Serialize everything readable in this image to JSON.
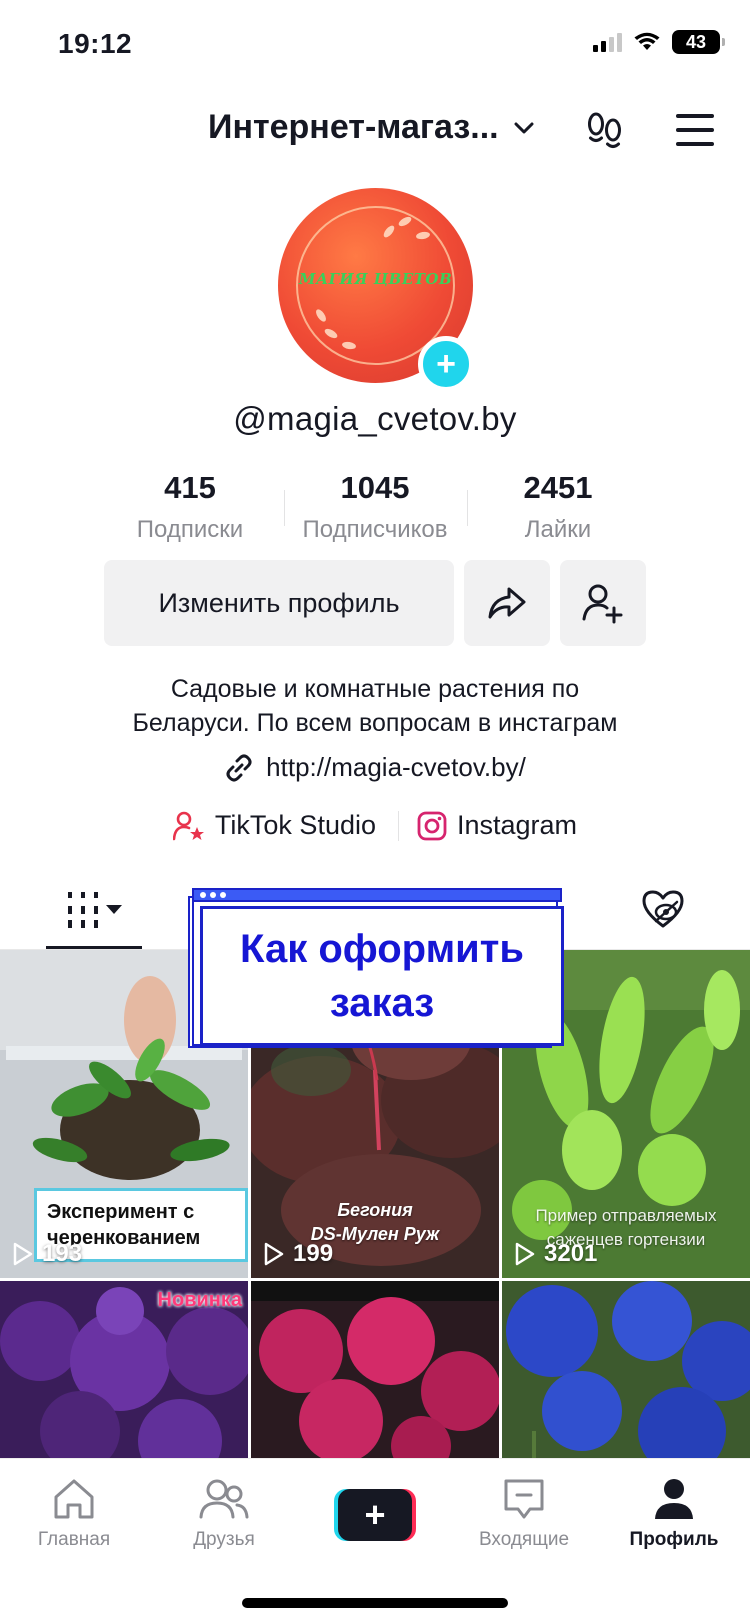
{
  "status": {
    "time": "19:12",
    "battery": "43"
  },
  "header": {
    "title": "Интернет-магаз..."
  },
  "profile": {
    "avatar_logo": "МАГИЯ ЦВЕТОВ",
    "username": "@magia_cvetov.by",
    "stats": [
      {
        "value": "415",
        "label": "Подписки"
      },
      {
        "value": "1045",
        "label": "Подписчиков"
      },
      {
        "value": "2451",
        "label": "Лайки"
      }
    ],
    "edit_button": "Изменить профиль",
    "bio_line1": "Садовые и комнатные растения по",
    "bio_line2": "Беларуси. По всем вопросам в инстаграм",
    "link": "http://magia-cvetov.by/",
    "extras": [
      {
        "label": "TikTok Studio"
      },
      {
        "label": "Instagram"
      }
    ]
  },
  "promo": {
    "line1": "Как оформить",
    "line2": "заказ"
  },
  "videos": [
    {
      "views": "193",
      "caption": "Эксперимент с черенкованием"
    },
    {
      "views": "199",
      "caption_line1": "Бегония",
      "caption_line2": "DS-Мулен Руж"
    },
    {
      "views": "3201",
      "caption_line1": "Пример отправляемых",
      "caption_line2": "саженцев гортензии"
    },
    {
      "badge": "Новинка"
    },
    {},
    {}
  ],
  "nav": {
    "home": "Главная",
    "friends": "Друзья",
    "inbox": "Входящие",
    "profile": "Профиль"
  },
  "colors": {
    "accent_cyan": "#20d5ec",
    "accent_red": "#fe2c55",
    "promo_blue": "#1616d4"
  }
}
